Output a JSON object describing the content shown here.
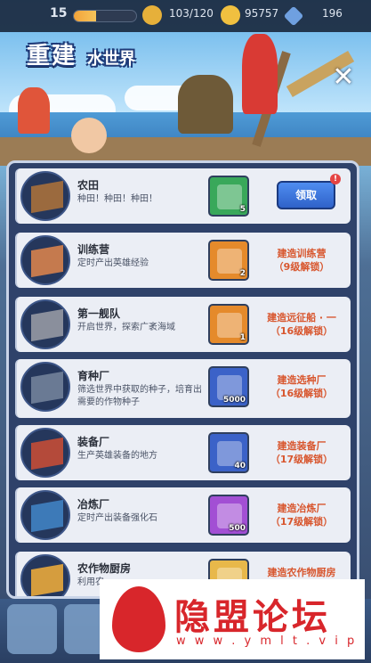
{
  "topbar": {
    "level": "15",
    "xp_progress": 0.35,
    "energy": "103/120",
    "coins": "95757",
    "gems": "196"
  },
  "banner": {
    "title_main": "重建",
    "title_sub": "水世界",
    "close_icon": "close-icon"
  },
  "buildings": [
    {
      "name": "农田",
      "desc": "种田！种田！种田！",
      "reward_count": "5",
      "reward_icon": "seed-bag-icon",
      "reward_bg": "#39a85a",
      "action": "领取",
      "claimable": true
    },
    {
      "name": "训练营",
      "desc": "定时产出英雄经验",
      "reward_count": "2",
      "reward_icon": "roth-card-icon",
      "reward_bg": "#e58a2b",
      "action": "建造训练营\n（9级解锁）",
      "claimable": false
    },
    {
      "name": "第一舰队",
      "desc": "开启世界，探索广袤海域",
      "reward_count": "1",
      "reward_icon": "frame-icon",
      "reward_bg": "#e58a2b",
      "action": "建造远征船 · 一\n（16级解锁）",
      "claimable": false
    },
    {
      "name": "育种厂",
      "desc": "筛选世界中获取的种子，培育出需要的作物种子",
      "reward_count": "5000",
      "reward_icon": "seed-pile-icon",
      "reward_bg": "#3b62c8",
      "action": "建造选种厂\n（16级解锁）",
      "claimable": false
    },
    {
      "name": "装备厂",
      "desc": "生产英雄装备的地方",
      "reward_count": "40",
      "reward_icon": "wrench-icon",
      "reward_bg": "#3b62c8",
      "action": "建造装备厂\n（17级解锁）",
      "claimable": false
    },
    {
      "name": "冶炼厂",
      "desc": "定时产出装备强化石",
      "reward_count": "500",
      "reward_icon": "lightning-stone-icon",
      "reward_bg": "#a24fd4",
      "action": "建造冶炼厂\n（17级解锁）",
      "claimable": false
    },
    {
      "name": "农作物厨房",
      "desc": "利用农",
      "reward_count": "",
      "reward_icon": "food-icon",
      "reward_bg": "#e8b84a",
      "action": "建造农作物厨房",
      "claimable": false
    }
  ],
  "watermark": {
    "title": "隐盟论坛",
    "url": "w w w . y m l t . v i p"
  },
  "colors": {
    "panel": "#2f426a",
    "row": "#ebeef5",
    "action_text": "#d8562e",
    "claim_button": "#2f62c9"
  }
}
